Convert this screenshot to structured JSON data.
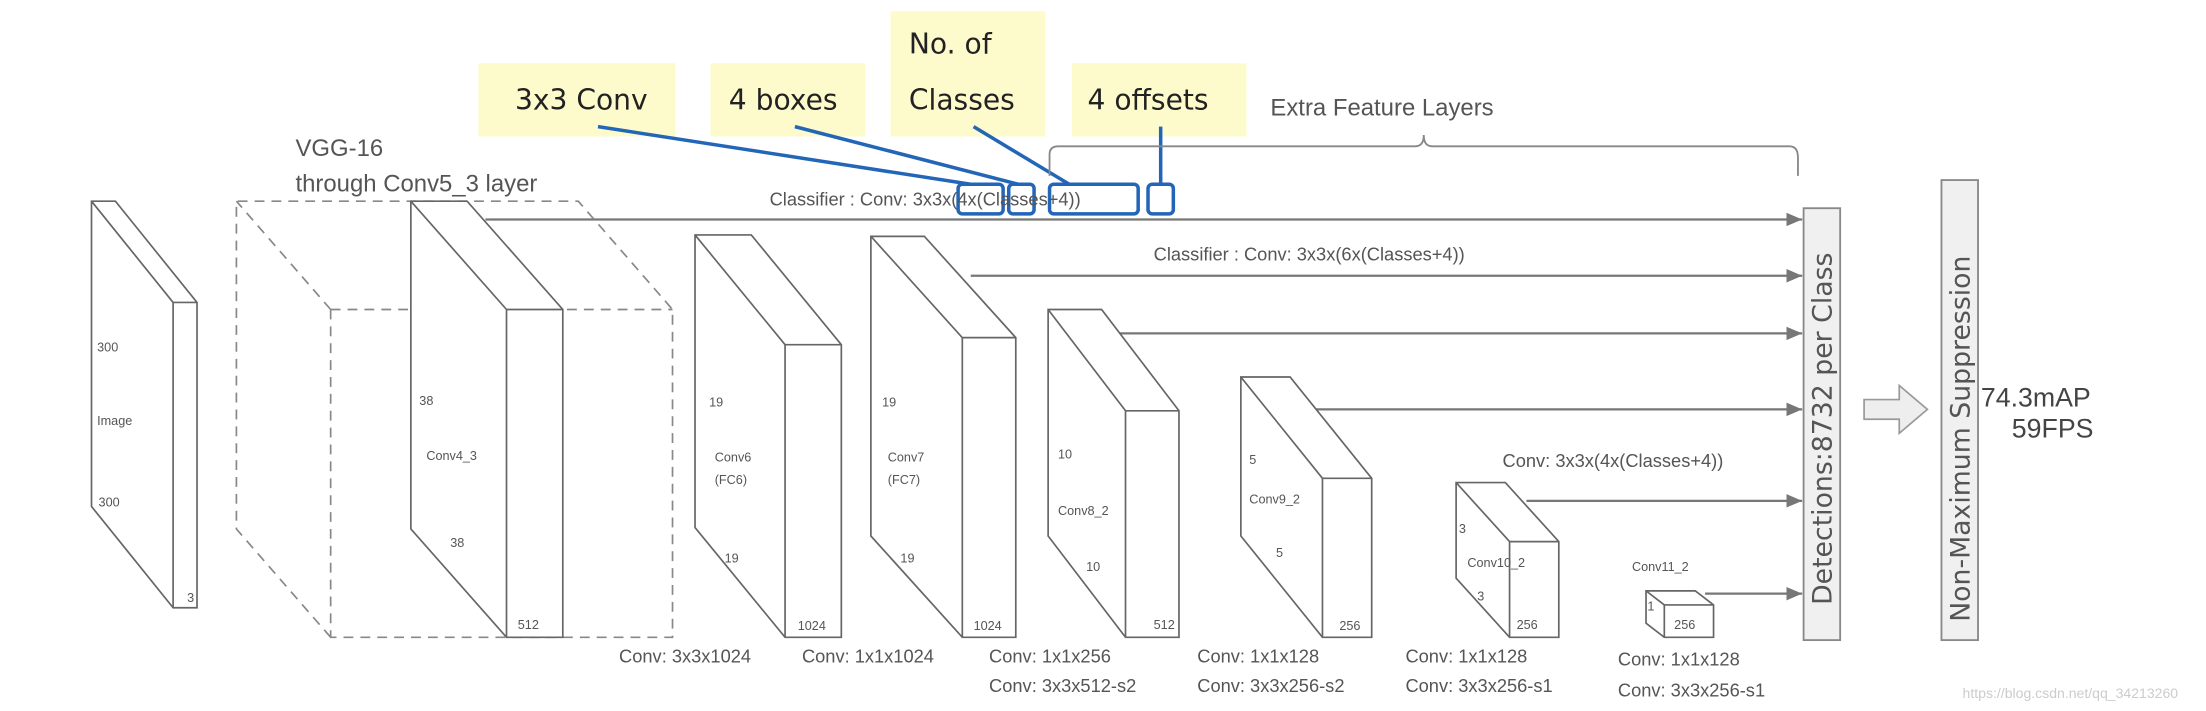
{
  "callouts": [
    {
      "label": "3x3 Conv"
    },
    {
      "label": "4 boxes"
    },
    {
      "label_line1": "No. of",
      "label_line2": "Classes"
    },
    {
      "label": "4 offsets"
    }
  ],
  "extra_feature_layers": "Extra Feature Layers",
  "vgg_label_line1": "VGG-16",
  "vgg_label_line2": "through Conv5_3 layer",
  "classifier_1": "Classifier : Conv: 3x3x(4x(Classes+4))",
  "classifier_2": "Classifier : Conv: 3x3x(6x(Classes+4))",
  "classifier_3": "Conv: 3x3x(4x(Classes+4))",
  "layers": {
    "image": {
      "name": "Image",
      "h": "300",
      "w": "300",
      "c": "3"
    },
    "conv4_3": {
      "name": "Conv4_3",
      "h": "38",
      "w": "38",
      "c": "512"
    },
    "conv6": {
      "name": "Conv6",
      "sub": "(FC6)",
      "h": "19",
      "w": "19",
      "c": "1024",
      "op1": "Conv: 3x3x1024"
    },
    "conv7": {
      "name": "Conv7",
      "sub": "(FC7)",
      "h": "19",
      "w": "19",
      "c": "1024",
      "op1": "Conv: 1x1x1024"
    },
    "conv8_2": {
      "name": "Conv8_2",
      "h": "10",
      "w": "10",
      "c": "512",
      "op1": "Conv: 1x1x256",
      "op2": "Conv:  3x3x512-s2"
    },
    "conv9_2": {
      "name": "Conv9_2",
      "h": "5",
      "w": "5",
      "c": "256",
      "op1": "Conv: 1x1x128",
      "op2": "Conv: 3x3x256-s2"
    },
    "conv10_2": {
      "name": "Conv10_2",
      "h": "3",
      "w": "3",
      "c": "256",
      "op1": "Conv: 1x1x128",
      "op2": "Conv: 3x3x256-s1"
    },
    "conv11_2": {
      "name": "Conv11_2",
      "h": "1",
      "c": "256",
      "op1": "Conv: 1x1x128",
      "op2": "Conv: 3x3x256-s1"
    }
  },
  "detections": "Detections:8732  per Class",
  "nms": "Non-Maximum Suppression",
  "result_map": "74.3mAP",
  "result_fps": "59FPS",
  "watermark": "https://blog.csdn.net/qq_34213260",
  "colors": {
    "callout_bg": "#fdfbcc",
    "callout_line": "#2366b8",
    "lines": "#777777"
  }
}
